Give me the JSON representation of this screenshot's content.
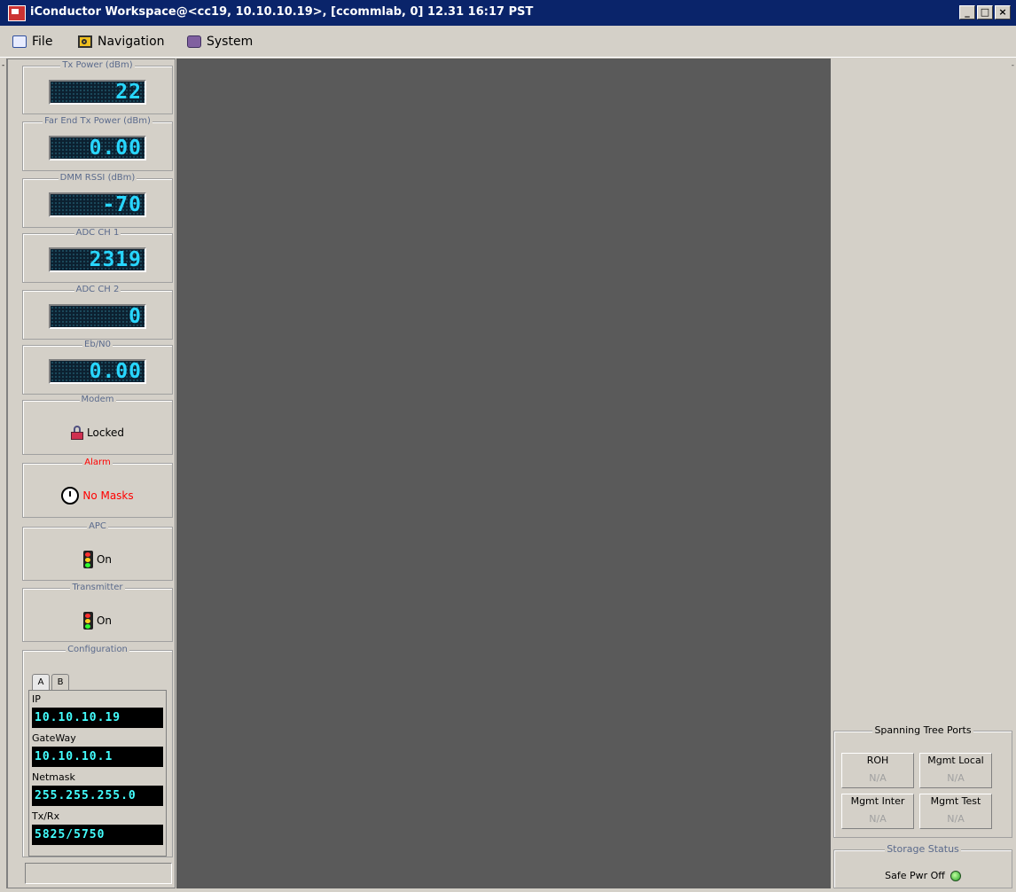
{
  "window": {
    "title": "iConductor Workspace@<cc19, 10.10.10.19>, [ccommlab, 0] 12.31 16:17 PST",
    "app_icon": "iconductor-app-icon",
    "controls": {
      "minimize": "_",
      "maximize": "□",
      "close": "×"
    }
  },
  "menu": {
    "items": [
      {
        "label": "File",
        "icon": "folder-icon"
      },
      {
        "label": "Navigation",
        "icon": "magnifier-icon"
      },
      {
        "label": "System",
        "icon": "system-icon"
      }
    ]
  },
  "left_panel": {
    "edge_mark": "-",
    "meters": [
      {
        "title": "Tx Power (dBm)",
        "value": "22"
      },
      {
        "title": "Far End Tx Power (dBm)",
        "value": "0.00"
      },
      {
        "title": "DMM RSSI (dBm)",
        "value": "-70"
      },
      {
        "title": "ADC CH 1",
        "value": "2319"
      },
      {
        "title": "ADC CH 2",
        "value": "0"
      },
      {
        "title": "Eb/N0",
        "value": "0.00"
      }
    ],
    "modem": {
      "title": "Modem",
      "status": "Locked",
      "icon": "lock-icon"
    },
    "alarm": {
      "title": "Alarm",
      "status": "No Masks",
      "icon": "alarm-clock-icon",
      "color": "#ff0000"
    },
    "apc": {
      "title": "APC",
      "status": "On",
      "icon": "traffic-light-icon"
    },
    "transmitter": {
      "title": "Transmitter",
      "status": "On",
      "icon": "traffic-light-icon"
    },
    "configuration": {
      "title": "Configuration",
      "tabs": [
        "A",
        "B"
      ],
      "active_tab": "A",
      "fields": [
        {
          "label": "IP",
          "value": "10.10.10.19"
        },
        {
          "label": "GateWay",
          "value": "10.10.10.1"
        },
        {
          "label": "Netmask",
          "value": "255.255.255.0"
        },
        {
          "label": "Tx/Rx",
          "value": "5825/5750"
        }
      ]
    }
  },
  "right_panel": {
    "edge_mark": "-",
    "spanning_tree": {
      "title": "Spanning Tree Ports",
      "ports": [
        {
          "label": "ROH",
          "value": "N/A"
        },
        {
          "label": "Mgmt Local",
          "value": "N/A"
        },
        {
          "label": "Mgmt Inter",
          "value": "N/A"
        },
        {
          "label": "Mgmt Test",
          "value": "N/A"
        }
      ]
    },
    "storage": {
      "title": "Storage Status",
      "label": "Safe Pwr Off",
      "led_color": "#20a020"
    }
  },
  "colors": {
    "title_bar": "#0a246a",
    "workspace": "#5a5a5a",
    "lcd_text": "#28d6ff",
    "config_text": "#44ffff",
    "legend_text": "#5a6a8c"
  }
}
